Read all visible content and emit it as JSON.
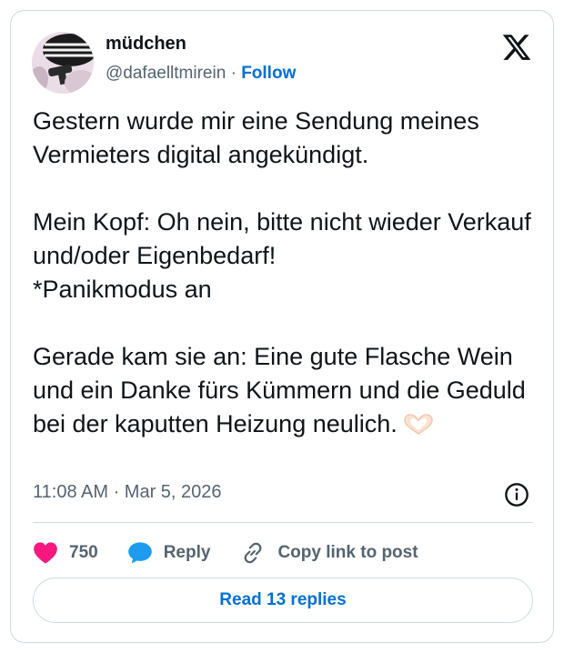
{
  "user": {
    "display_name": "müdchen",
    "handle": "@dafaelltmirein",
    "separator": "·",
    "follow_label": "Follow"
  },
  "tweet": {
    "text": "Gestern wurde mir eine Sendung meines Vermieters digital angekündigt.\n\nMein Kopf: Oh nein, bitte nicht wieder Verkauf und/oder Eigenbedarf!\n*Panikmodus an\n\nGerade kam sie an: Eine gute Flasche Wein und ein Danke fürs Kümmern und die Geduld bei der kaputten Heizung neulich.",
    "emoji": "heart-hands",
    "timestamp": "11:08 AM · Mar 5, 2026"
  },
  "actions": {
    "like_count": "750",
    "reply_label": "Reply",
    "copy_label": "Copy link to post"
  },
  "replies_button": "Read 13 replies",
  "colors": {
    "accent": "#006fd6",
    "like": "#f91880",
    "reply_icon": "#1d9bf0",
    "muted": "#536471",
    "border": "#cfd9de"
  },
  "icons": [
    "x-logo-icon",
    "info-icon",
    "heart-icon",
    "reply-bubble-icon",
    "link-icon",
    "heart-hands-emoji"
  ]
}
